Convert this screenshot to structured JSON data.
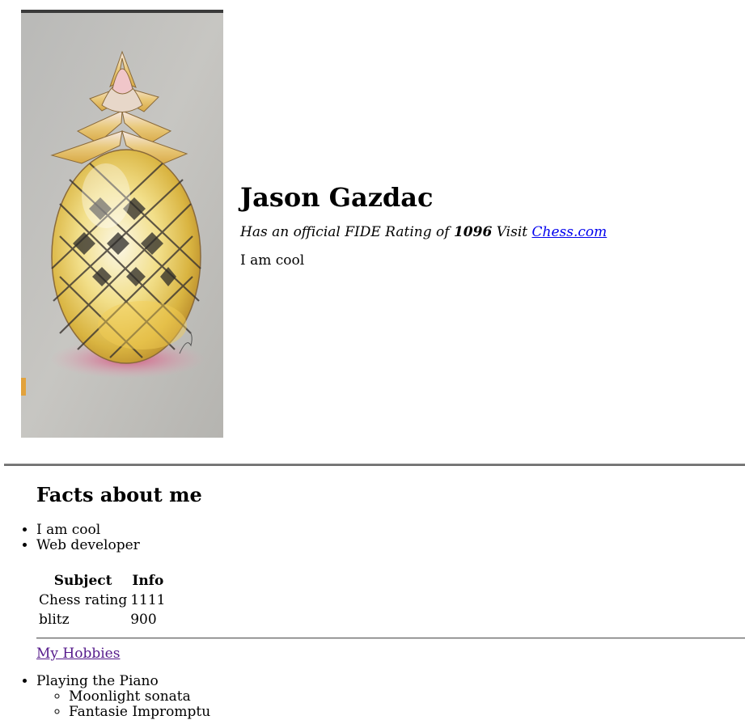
{
  "profile": {
    "name": "Jason Gazdac",
    "rating_prefix": "Has an official FIDE Rating of",
    "rating_value": "1096",
    "visit_text": "Visit",
    "chess_link": "Chess.com",
    "tagline": "I am cool",
    "portrait_subject": "pineapple-drawing"
  },
  "facts": {
    "heading": "Facts about me",
    "items": [
      "I am cool",
      "Web developer"
    ]
  },
  "table": {
    "headers": [
      "Subject",
      "Info"
    ],
    "rows": [
      [
        "Chess rating",
        "1111"
      ],
      [
        "blitz",
        "900"
      ]
    ]
  },
  "hobbies": {
    "link_text": "My Hobbies",
    "items": [
      {
        "label": "Playing the Piano",
        "subitems": [
          "Moonlight sonata",
          "Fantasie Impromptu"
        ]
      }
    ]
  },
  "colors": {
    "link": "#0000ee",
    "visited_link": "#551a8b",
    "rule": "#707070"
  }
}
